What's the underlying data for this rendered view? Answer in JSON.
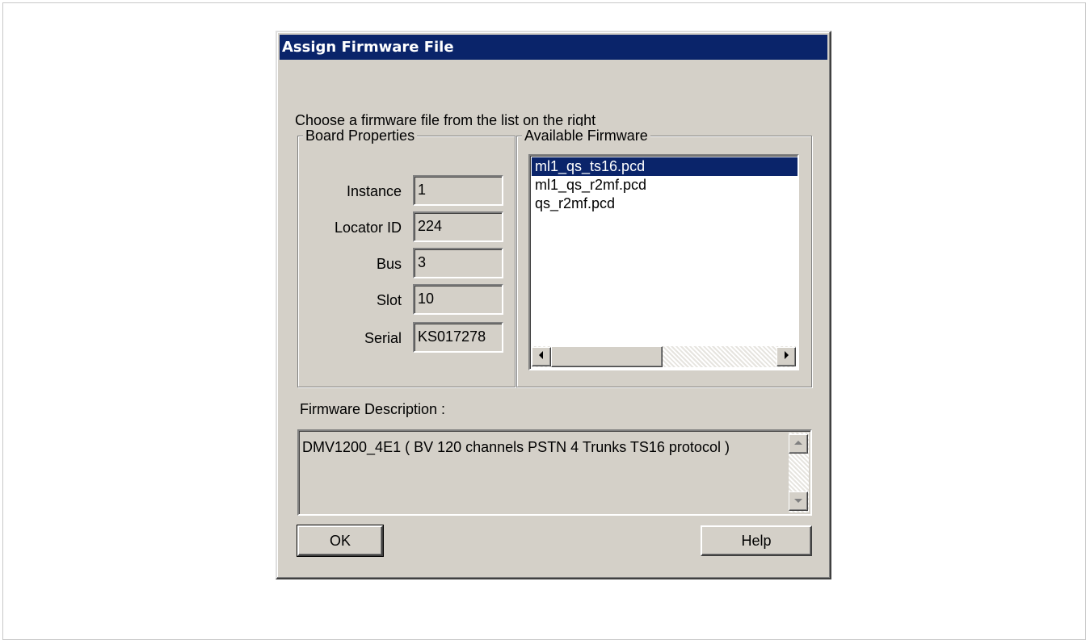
{
  "dialog": {
    "title": "Assign Firmware File",
    "instruction": "Choose a firmware file from the list on the right",
    "board_properties": {
      "legend": "Board Properties",
      "fields": [
        {
          "label": "Instance",
          "value": "1"
        },
        {
          "label": "Locator ID",
          "value": "224"
        },
        {
          "label": "Bus",
          "value": "3"
        },
        {
          "label": "Slot",
          "value": "10"
        },
        {
          "label": "Serial",
          "value": "KS017278"
        }
      ]
    },
    "available_firmware": {
      "legend": "Available Firmware",
      "items": [
        "ml1_qs_ts16.pcd",
        "ml1_qs_r2mf.pcd",
        "qs_r2mf.pcd"
      ],
      "selected": "ml1_qs_ts16.pcd"
    },
    "firmware_description": {
      "label": "Firmware Description :",
      "text": "DMV1200_4E1 ( BV 120 channels PSTN 4 Trunks TS16 protocol )"
    },
    "buttons": {
      "ok": "OK",
      "help": "Help"
    }
  },
  "colors": {
    "titlebar": "#0a246a",
    "face": "#d4d0c8",
    "selection": "#0a246a"
  },
  "icons": {
    "scroll_left": "arrow-left-icon",
    "scroll_right": "arrow-right-icon",
    "scroll_up": "arrow-up-icon",
    "scroll_down": "arrow-down-icon"
  }
}
